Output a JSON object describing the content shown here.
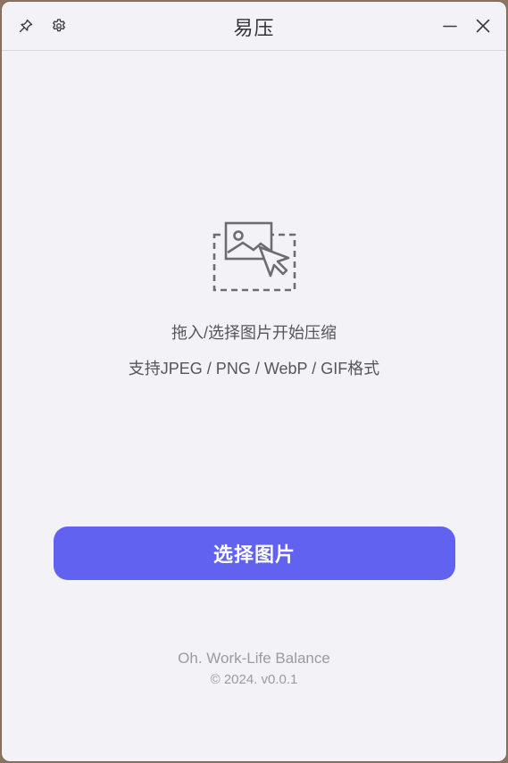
{
  "app": {
    "title": "易压"
  },
  "titlebar": {
    "pin_icon": "pin-icon",
    "settings_icon": "gear-icon",
    "minimize_icon": "minimize-icon",
    "close_icon": "close-icon"
  },
  "dropzone": {
    "icon": "image-cursor-icon",
    "hint_primary": "拖入/选择图片开始压缩",
    "hint_formats": "支持JPEG / PNG / WebP / GIF格式"
  },
  "actions": {
    "select_label": "选择图片"
  },
  "footer": {
    "slogan": "Oh. Work-Life Balance",
    "version": "© 2024. v0.0.1"
  },
  "colors": {
    "accent": "#6162f0",
    "background": "#f3f2f7",
    "text_primary": "#333339",
    "text_secondary": "#56555c",
    "text_muted": "#9b9aa1"
  }
}
